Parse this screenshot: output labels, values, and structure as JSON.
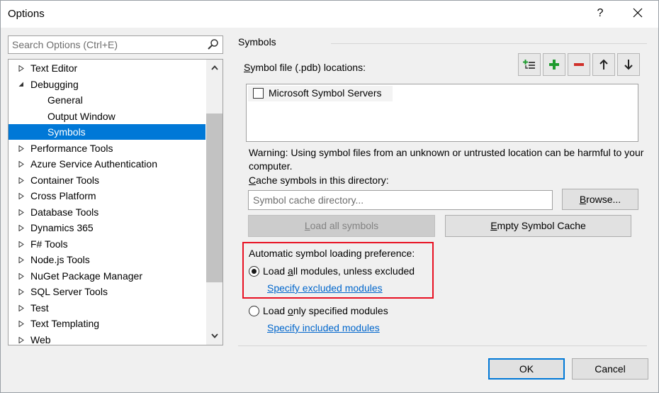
{
  "window": {
    "title": "Options",
    "help_label": "?"
  },
  "search": {
    "placeholder": "Search Options (Ctrl+E)"
  },
  "tree": {
    "items": [
      {
        "label": "Text Editor",
        "expanded": false
      },
      {
        "label": "Debugging",
        "expanded": true
      },
      {
        "label": "General"
      },
      {
        "label": "Output Window"
      },
      {
        "label": "Symbols",
        "selected": true
      },
      {
        "label": "Performance Tools",
        "expanded": false
      },
      {
        "label": "Azure Service Authentication",
        "expanded": false
      },
      {
        "label": "Container Tools",
        "expanded": false
      },
      {
        "label": "Cross Platform",
        "expanded": false
      },
      {
        "label": "Database Tools",
        "expanded": false
      },
      {
        "label": "Dynamics 365",
        "expanded": false
      },
      {
        "label": "F# Tools",
        "expanded": false
      },
      {
        "label": "Node.js Tools",
        "expanded": false
      },
      {
        "label": "NuGet Package Manager",
        "expanded": false
      },
      {
        "label": "SQL Server Tools",
        "expanded": false
      },
      {
        "label": "Test",
        "expanded": false
      },
      {
        "label": "Text Templating",
        "expanded": false
      },
      {
        "label": "Web",
        "expanded": false
      }
    ]
  },
  "symbols": {
    "section_title": "Symbols",
    "pdb_label_pre": "",
    "pdb_label_key": "S",
    "pdb_label_post": "ymbol file (.pdb) locations:",
    "toolbar_icons": [
      "add-location-icon",
      "plus-icon",
      "minus-icon",
      "arrow-up-icon",
      "arrow-down-icon"
    ],
    "locations": [
      {
        "label": "Microsoft Symbol Servers",
        "checked": false
      }
    ],
    "warning": "Warning: Using symbol files from an unknown or untrusted location can be harmful to your computer.",
    "cache_label_key": "C",
    "cache_label_post": "ache symbols in this directory:",
    "cache_placeholder": "Symbol cache directory...",
    "browse_key": "B",
    "browse_post": "rowse...",
    "load_all_key": "L",
    "load_all_post": "oad all symbols",
    "empty_cache_key": "E",
    "empty_cache_post": "mpty Symbol Cache",
    "pref_title": "Automatic symbol loading preference:",
    "opt1_pre": "Load ",
    "opt1_key": "a",
    "opt1_post": "ll modules, unless excluded",
    "opt1_checked": true,
    "link_excluded": "Specify excluded modules",
    "opt2_pre": "Load ",
    "opt2_key": "o",
    "opt2_post": "nly specified modules",
    "opt2_checked": false,
    "link_included": "Specify included modules"
  },
  "footer": {
    "ok_label": "OK",
    "cancel_label": "Cancel"
  },
  "colors": {
    "selection": "#0078d7",
    "link": "#0066cc",
    "highlight_border": "#e81123",
    "plus_green": "#1e9a2e",
    "minus_red": "#d0302a"
  }
}
